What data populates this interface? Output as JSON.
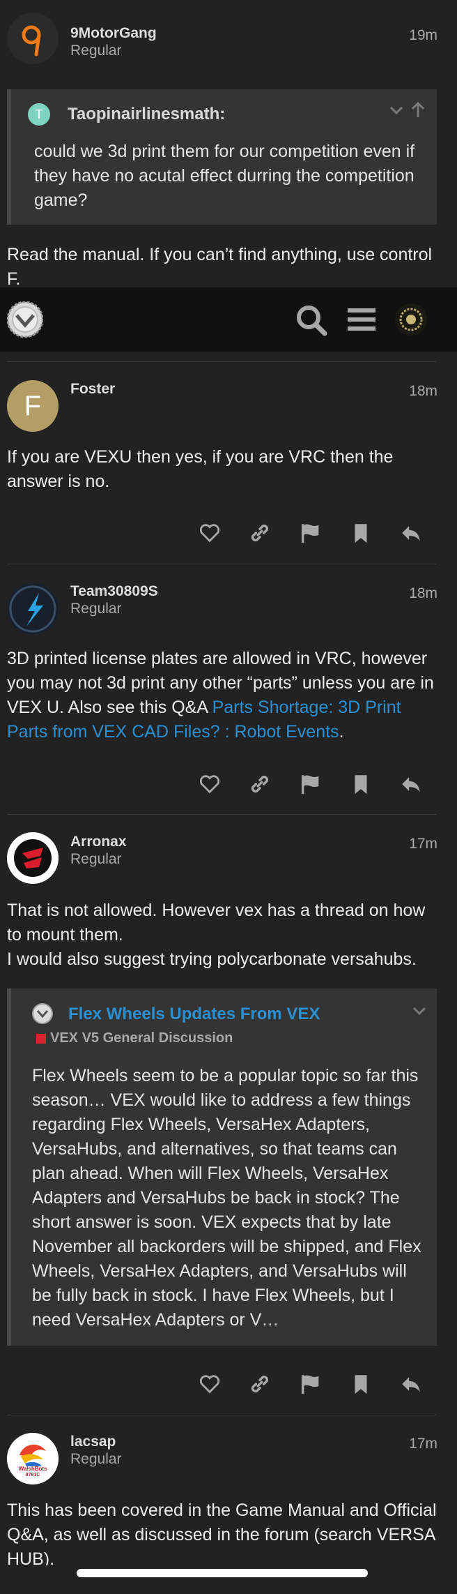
{
  "posts": [
    {
      "username": "9MotorGang",
      "user_title": "Regular",
      "time": "19m",
      "quote": {
        "author": "Taopinairlinesmath:",
        "text": "could we 3d print them for our competition even if they have no acutal effect durring the competition game?"
      },
      "body": "Read the manual. If you can’t find anything, use control F."
    },
    {
      "username": "Foster",
      "user_title": "",
      "time": "18m",
      "avatar_letter": "F",
      "body": "If you are VEXU then yes, if you are VRC then the answer is no."
    },
    {
      "username": "Team30809S",
      "user_title": "Regular",
      "time": "18m",
      "body_prefix": "3D printed license plates are allowed in VRC, however you may not 3d print any other “parts” unless you are in VEX U. Also see this Q&A ",
      "link_text": "Parts Shortage: 3D Print Parts from VEX CAD Files? : Robot Events",
      "body_suffix": "."
    },
    {
      "username": "Arronax",
      "user_title": "Regular",
      "time": "17m",
      "body_line1": "That is not allowed. However vex has a thread on how to mount them.",
      "body_line2": "I would also suggest trying polycarbonate versahubs.",
      "onebox": {
        "title": "Flex Wheels Updates From VEX",
        "category": "VEX V5 General Discussion",
        "excerpt": "Flex Wheels seem to be a popular topic so far this season… VEX would like to address a few things regarding Flex Wheels, VersaHex Adapters, VersaHubs, and alternatives, so that teams can plan ahead. When will Flex Wheels, VersaHex Adapters and VersaHubs be back in stock? The short answer is soon. VEX expects that by late November all backorders will be shipped, and Flex Wheels, VersaHex Adapters, and VersaHubs will be fully back in stock. I have Flex Wheels, but I need VersaHex Adapters or V…"
      }
    },
    {
      "username": "lacsap",
      "user_title": "Regular",
      "time": "17m",
      "avatar_text_1": "WalshBots",
      "avatar_text_2": "9791C",
      "body": "This has been covered in the Game Manual and Official Q&A, as well as discussed in the forum (search VERSA HUB)."
    }
  ],
  "icons": {
    "like": "heart-icon",
    "link": "link-icon",
    "flag": "flag-icon",
    "bookmark": "bookmark-icon",
    "reply": "reply-icon",
    "search": "search-icon",
    "menu": "hamburger-menu-icon"
  },
  "colors": {
    "background": "#222222",
    "link": "#2a90d2",
    "header": "#111111",
    "quote_bg": "#343434"
  }
}
